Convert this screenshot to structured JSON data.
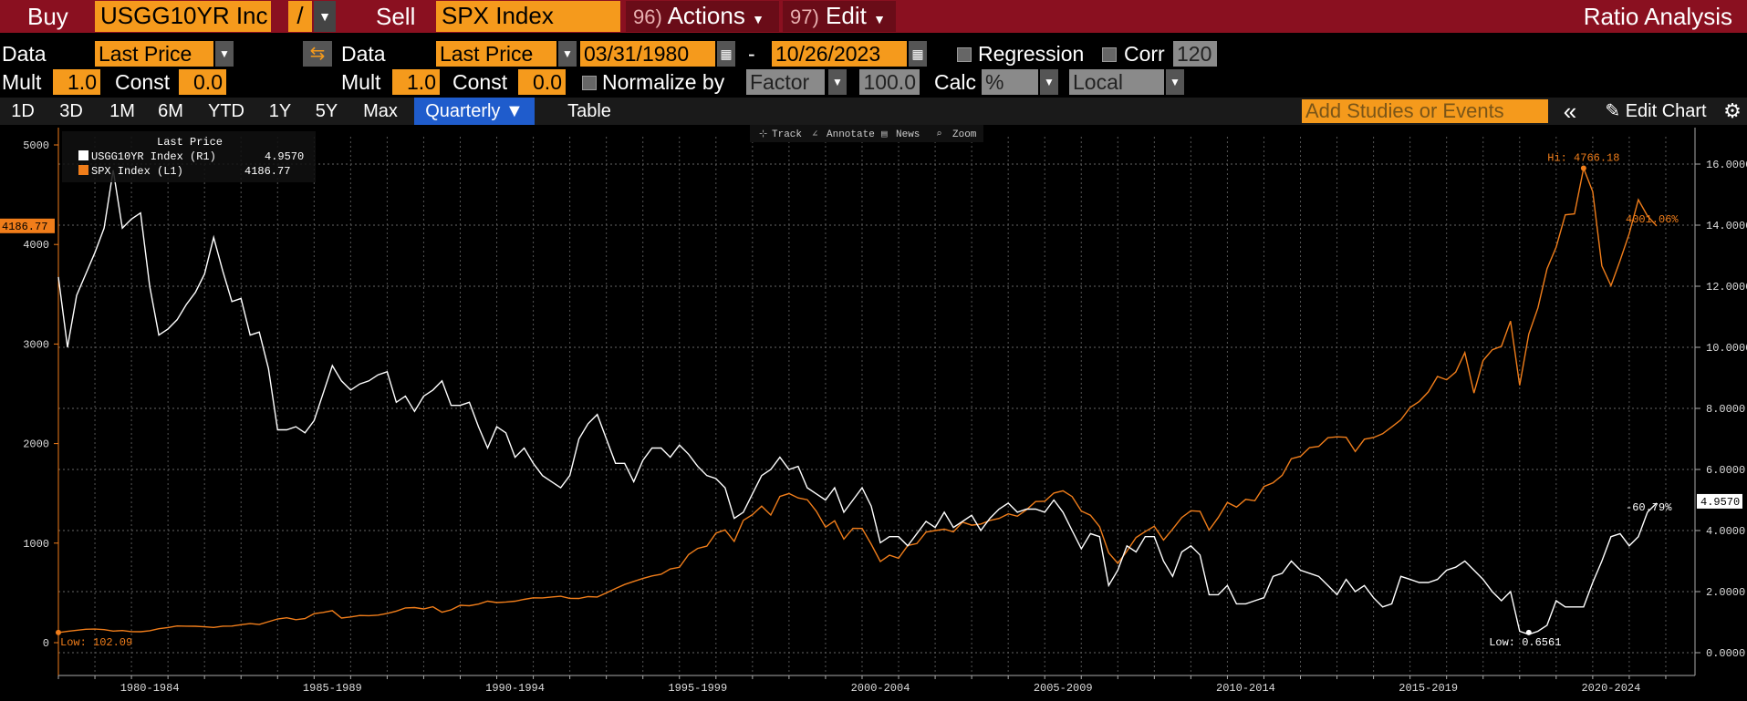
{
  "header": {
    "buy_label": "Buy",
    "buy_ticker": "USGG10YR Inc",
    "operator": "/",
    "sell_label": "Sell",
    "sell_ticker": "SPX Index",
    "actions_num": "96)",
    "actions_label": "Actions",
    "edit_num": "97)",
    "edit_label": "Edit",
    "title": "Ratio Analysis"
  },
  "row2": {
    "data_label": "Data",
    "data1_value": "Last Price",
    "data2_label": "Data",
    "data2_value": "Last Price",
    "start_date": "03/31/1980",
    "dash": "-",
    "end_date": "10/26/2023",
    "regression_label": "Regression",
    "corr_label": "Corr",
    "corr_value": "120"
  },
  "row3": {
    "mult_label": "Mult",
    "mult1": "1.0",
    "const_label": "Const",
    "const1": "0.0",
    "mult2_label": "Mult",
    "mult2": "1.0",
    "const2_label": "Const",
    "const2": "0.0",
    "normalize_label": "Normalize by",
    "normalize_value": "Factor",
    "factor_value": "100.0",
    "calc_label": "Calc",
    "calc_value": "%",
    "local_value": "Local"
  },
  "toolbar": {
    "periods": [
      "1D",
      "3D",
      "1M",
      "6M",
      "YTD",
      "1Y",
      "5Y",
      "Max"
    ],
    "frequency": "Quarterly ▼",
    "table_label": "Table",
    "studies_placeholder": "Add Studies or Events",
    "collapse_icon": "«",
    "edit_chart": "Edit Chart",
    "gear_icon": "⚙"
  },
  "chart_tools": [
    "Track",
    "Annotate",
    "News",
    "Zoom"
  ],
  "colors": {
    "header_bg": "#8a1020",
    "accent_orange": "#f59a1c",
    "spx_line": "#f07d1a",
    "yield_line": "#ffffff"
  },
  "chart_data": {
    "type": "line",
    "legend_title": "Last Price",
    "x_tick_labels": [
      "1980-1984",
      "1985-1989",
      "1990-1994",
      "1995-1999",
      "2000-2004",
      "2005-2009",
      "2010-2014",
      "2015-2019",
      "2020-2024"
    ],
    "left_axis": {
      "ticks": [
        0,
        1000,
        2000,
        3000,
        4000,
        5000
      ],
      "range": [
        0,
        5000
      ]
    },
    "right_axis": {
      "ticks": [
        "0.0000",
        "2.0000",
        "4.0000",
        "6.0000",
        "8.0000",
        "10.0000",
        "12.0000",
        "14.0000",
        "16.0000"
      ],
      "range": [
        0,
        16
      ]
    },
    "x_range": [
      1980.0,
      2024.8
    ],
    "series": [
      {
        "name": "USGG10YR Index  (R1)",
        "legend_value": "4.9570",
        "axis": "right",
        "last_label": "4.9570",
        "change_label": "-60.79%",
        "x": [
          1980.0,
          1980.25,
          1980.5,
          1980.75,
          1981.0,
          1981.25,
          1981.5,
          1981.75,
          1982.0,
          1982.25,
          1982.5,
          1982.75,
          1983.0,
          1983.25,
          1983.5,
          1983.75,
          1984.0,
          1984.25,
          1984.5,
          1984.75,
          1985.0,
          1985.25,
          1985.5,
          1985.75,
          1986.0,
          1986.25,
          1986.5,
          1986.75,
          1987.0,
          1987.25,
          1987.5,
          1987.75,
          1988.0,
          1988.25,
          1988.5,
          1988.75,
          1989.0,
          1989.25,
          1989.5,
          1989.75,
          1990.0,
          1990.25,
          1990.5,
          1990.75,
          1991.0,
          1991.25,
          1991.5,
          1991.75,
          1992.0,
          1992.25,
          1992.5,
          1992.75,
          1993.0,
          1993.25,
          1993.5,
          1993.75,
          1994.0,
          1994.25,
          1994.5,
          1994.75,
          1995.0,
          1995.25,
          1995.5,
          1995.75,
          1996.0,
          1996.25,
          1996.5,
          1996.75,
          1997.0,
          1997.25,
          1997.5,
          1997.75,
          1998.0,
          1998.25,
          1998.5,
          1998.75,
          1999.0,
          1999.25,
          1999.5,
          1999.75,
          2000.0,
          2000.25,
          2000.5,
          2000.75,
          2001.0,
          2001.25,
          2001.5,
          2001.75,
          2002.0,
          2002.25,
          2002.5,
          2002.75,
          2003.0,
          2003.25,
          2003.5,
          2003.75,
          2004.0,
          2004.25,
          2004.5,
          2004.75,
          2005.0,
          2005.25,
          2005.5,
          2005.75,
          2006.0,
          2006.25,
          2006.5,
          2006.75,
          2007.0,
          2007.25,
          2007.5,
          2007.75,
          2008.0,
          2008.25,
          2008.5,
          2008.75,
          2009.0,
          2009.25,
          2009.5,
          2009.75,
          2010.0,
          2010.25,
          2010.5,
          2010.75,
          2011.0,
          2011.25,
          2011.5,
          2011.75,
          2012.0,
          2012.25,
          2012.5,
          2012.75,
          2013.0,
          2013.25,
          2013.5,
          2013.75,
          2014.0,
          2014.25,
          2014.5,
          2014.75,
          2015.0,
          2015.25,
          2015.5,
          2015.75,
          2016.0,
          2016.25,
          2016.5,
          2016.75,
          2017.0,
          2017.25,
          2017.5,
          2017.75,
          2018.0,
          2018.25,
          2018.5,
          2018.75,
          2019.0,
          2019.25,
          2019.5,
          2019.75,
          2020.0,
          2020.25,
          2020.5,
          2020.75,
          2021.0,
          2021.25,
          2021.5,
          2021.75,
          2022.0,
          2022.25,
          2022.5,
          2022.75,
          2023.0,
          2023.25,
          2023.5,
          2023.75
        ],
        "y": [
          12.3,
          10.0,
          11.7,
          12.4,
          13.1,
          13.9,
          15.8,
          13.9,
          14.2,
          14.4,
          12.0,
          10.4,
          10.6,
          10.9,
          11.4,
          11.8,
          12.4,
          13.6,
          12.5,
          11.5,
          11.6,
          10.4,
          10.5,
          9.3,
          7.3,
          7.3,
          7.4,
          7.2,
          7.6,
          8.5,
          9.4,
          8.9,
          8.6,
          8.8,
          8.9,
          9.1,
          9.2,
          8.2,
          8.4,
          7.9,
          8.4,
          8.6,
          8.9,
          8.1,
          8.1,
          8.2,
          7.4,
          6.7,
          7.4,
          7.2,
          6.4,
          6.7,
          6.2,
          5.8,
          5.6,
          5.4,
          5.8,
          7.0,
          7.5,
          7.8,
          7.0,
          6.2,
          6.2,
          5.6,
          6.3,
          6.7,
          6.7,
          6.4,
          6.8,
          6.5,
          6.1,
          5.8,
          5.7,
          5.4,
          4.4,
          4.6,
          5.2,
          5.8,
          6.0,
          6.4,
          6.0,
          6.1,
          5.4,
          5.2,
          5.0,
          5.4,
          4.6,
          5.0,
          5.4,
          4.8,
          3.6,
          3.8,
          3.8,
          3.5,
          3.9,
          4.3,
          4.1,
          4.6,
          4.1,
          4.3,
          4.5,
          4.0,
          4.4,
          4.7,
          4.9,
          4.6,
          4.7,
          4.7,
          4.6,
          5.0,
          4.6,
          4.0,
          3.4,
          3.9,
          3.8,
          2.2,
          2.7,
          3.5,
          3.3,
          3.8,
          3.8,
          3.0,
          2.5,
          3.3,
          3.5,
          3.2,
          1.9,
          1.9,
          2.2,
          1.6,
          1.6,
          1.7,
          1.8,
          2.5,
          2.6,
          3.0,
          2.7,
          2.6,
          2.5,
          2.2,
          1.9,
          2.4,
          2.0,
          2.2,
          1.8,
          1.5,
          1.6,
          2.5,
          2.4,
          2.3,
          2.3,
          2.4,
          2.7,
          2.8,
          3.0,
          2.7,
          2.4,
          2.0,
          1.7,
          2.0,
          0.7,
          0.6,
          0.7,
          0.9,
          1.7,
          1.5,
          1.5,
          1.5,
          2.3,
          3.0,
          3.8,
          3.9,
          3.5,
          3.8,
          4.6,
          4.9
        ]
      },
      {
        "name": "SPX Index  (L1)",
        "legend_value": "4186.77",
        "axis": "left",
        "last_label": "4001.06%",
        "axis_tag": "4186.77",
        "x": [
          1980.0,
          1980.25,
          1980.5,
          1980.75,
          1981.0,
          1981.25,
          1981.5,
          1981.75,
          1982.0,
          1982.25,
          1982.5,
          1982.75,
          1983.0,
          1983.25,
          1983.5,
          1983.75,
          1984.0,
          1984.25,
          1984.5,
          1984.75,
          1985.0,
          1985.25,
          1985.5,
          1985.75,
          1986.0,
          1986.25,
          1986.5,
          1986.75,
          1987.0,
          1987.25,
          1987.5,
          1987.75,
          1988.0,
          1988.25,
          1988.5,
          1988.75,
          1989.0,
          1989.25,
          1989.5,
          1989.75,
          1990.0,
          1990.25,
          1990.5,
          1990.75,
          1991.0,
          1991.25,
          1991.5,
          1991.75,
          1992.0,
          1992.25,
          1992.5,
          1992.75,
          1993.0,
          1993.25,
          1993.5,
          1993.75,
          1994.0,
          1994.25,
          1994.5,
          1994.75,
          1995.0,
          1995.25,
          1995.5,
          1995.75,
          1996.0,
          1996.25,
          1996.5,
          1996.75,
          1997.0,
          1997.25,
          1997.5,
          1997.75,
          1998.0,
          1998.25,
          1998.5,
          1998.75,
          1999.0,
          1999.25,
          1999.5,
          1999.75,
          2000.0,
          2000.25,
          2000.5,
          2000.75,
          2001.0,
          2001.25,
          2001.5,
          2001.75,
          2002.0,
          2002.25,
          2002.5,
          2002.75,
          2003.0,
          2003.25,
          2003.5,
          2003.75,
          2004.0,
          2004.25,
          2004.5,
          2004.75,
          2005.0,
          2005.25,
          2005.5,
          2005.75,
          2006.0,
          2006.25,
          2006.5,
          2006.75,
          2007.0,
          2007.25,
          2007.5,
          2007.75,
          2008.0,
          2008.25,
          2008.5,
          2008.75,
          2009.0,
          2009.25,
          2009.5,
          2009.75,
          2010.0,
          2010.25,
          2010.5,
          2010.75,
          2011.0,
          2011.25,
          2011.5,
          2011.75,
          2012.0,
          2012.25,
          2012.5,
          2012.75,
          2013.0,
          2013.25,
          2013.5,
          2013.75,
          2014.0,
          2014.25,
          2014.5,
          2014.75,
          2015.0,
          2015.25,
          2015.5,
          2015.75,
          2016.0,
          2016.25,
          2016.5,
          2016.75,
          2017.0,
          2017.25,
          2017.5,
          2017.75,
          2018.0,
          2018.25,
          2018.5,
          2018.75,
          2019.0,
          2019.25,
          2019.5,
          2019.75,
          2020.0,
          2020.25,
          2020.5,
          2020.75,
          2021.0,
          2021.25,
          2021.5,
          2021.75,
          2022.0,
          2022.25,
          2022.5,
          2022.75,
          2023.0,
          2023.25,
          2023.5,
          2023.75
        ],
        "y": [
          102,
          114,
          125,
          135,
          136,
          131,
          116,
          122,
          111,
          110,
          120,
          140,
          152,
          168,
          166,
          165,
          159,
          153,
          166,
          167,
          180,
          191,
          182,
          211,
          238,
          250,
          231,
          242,
          291,
          304,
          321,
          247,
          258,
          273,
          271,
          277,
          294,
          317,
          349,
          353,
          339,
          361,
          306,
          330,
          375,
          371,
          387,
          417,
          403,
          408,
          417,
          435,
          451,
          450,
          459,
          466,
          445,
          444,
          462,
          459,
          500,
          544,
          584,
          615,
          645,
          670,
          687,
          740,
          757,
          885,
          947,
          970,
          1101,
          1133,
          1017,
          1229,
          1286,
          1372,
          1282,
          1469,
          1498,
          1454,
          1436,
          1320,
          1160,
          1224,
          1040,
          1148,
          1147,
          989,
          815,
          879,
          848,
          975,
          995,
          1111,
          1126,
          1140,
          1114,
          1211,
          1180,
          1191,
          1228,
          1248,
          1294,
          1270,
          1335,
          1418,
          1420,
          1503,
          1526,
          1468,
          1322,
          1280,
          1166,
          903,
          797,
          919,
          1057,
          1115,
          1169,
          1031,
          1141,
          1257,
          1325,
          1320,
          1131,
          1257,
          1408,
          1362,
          1440,
          1426,
          1569,
          1606,
          1681,
          1848,
          1872,
          1960,
          1972,
          2059,
          2068,
          2063,
          1920,
          2044,
          2060,
          2099,
          2168,
          2239,
          2363,
          2423,
          2519,
          2674,
          2641,
          2718,
          2914,
          2507,
          2834,
          2942,
          2977,
          3231,
          2585,
          3100,
          3363,
          3756,
          3973,
          4298,
          4308,
          4766,
          4530,
          3785,
          3586,
          3840,
          4109,
          4450,
          4288,
          4186
        ]
      }
    ],
    "annotations": [
      {
        "text": "Hi: 4766.18",
        "series": "SPX Index",
        "x": 2021.75,
        "y": 4766
      },
      {
        "text": "Low: 102.09",
        "series": "SPX Index",
        "x": 1980.0,
        "y": 102
      },
      {
        "text": "Low: 0.6561",
        "series": "USGG10YR Index",
        "x": 2020.25,
        "y": 0.66
      }
    ]
  }
}
